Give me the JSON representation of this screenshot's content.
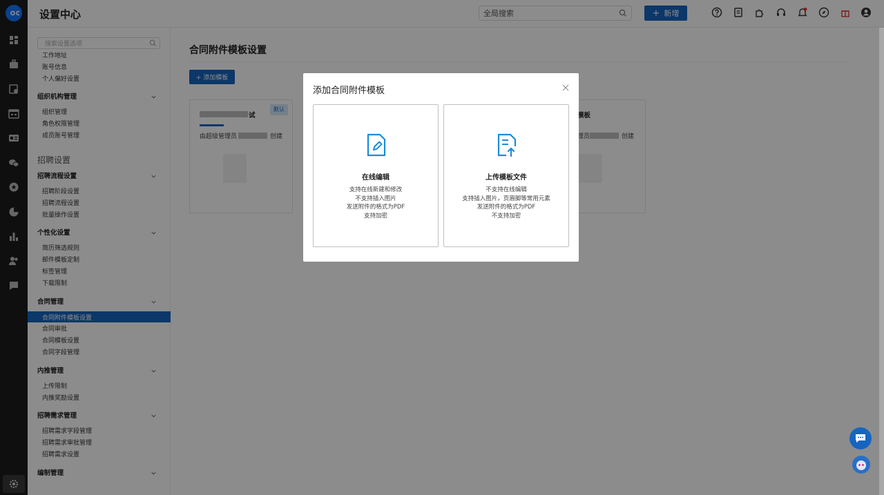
{
  "header": {
    "title": "设置中心",
    "search_placeholder": "全局搜索",
    "new_label": "新增"
  },
  "sidebar": {
    "search_placeholder": "搜索设置选项",
    "top_items": [
      "工作地址",
      "账号信息",
      "个人偏好设置"
    ],
    "groups": [
      {
        "label": "组织机构管理",
        "items": [
          "组织管理",
          "角色权限管理",
          "成员账号管理"
        ]
      },
      {
        "label": "招聘流程设置",
        "items": [
          "招聘阶段设置",
          "招聘流程设置",
          "批量操作设置"
        ]
      },
      {
        "label": "个性化设置",
        "items": [
          "简历筛选规则",
          "邮件模板定制",
          "标签管理",
          "下载限制"
        ]
      },
      {
        "label": "合同管理",
        "items": [
          "合同附件模板设置",
          "合同审批",
          "合同模板设置",
          "合同字段管理"
        ]
      },
      {
        "label": "内推管理",
        "items": [
          "上传限制",
          "内推奖励设置"
        ]
      },
      {
        "label": "招聘需求管理",
        "items": [
          "招聘需求字段管理",
          "招聘需求审批管理",
          "招聘需求设置"
        ]
      },
      {
        "label": "编制管理",
        "items": []
      }
    ],
    "section_label": "招聘设置",
    "active_item": "合同附件模板设置"
  },
  "main": {
    "page_title": "合同附件模板设置",
    "add_button": "+ 添加模板",
    "cards": [
      {
        "name_suffix": "试",
        "badge": "默认",
        "creator_prefix": "由超级管理员",
        "creator_suffix": "创建"
      },
      {
        "name_suffix": "模板",
        "creator_prefix": "理员",
        "creator_suffix": "创建"
      }
    ]
  },
  "modal": {
    "title": "添加合同附件模板",
    "options": [
      {
        "name": "在线编辑",
        "icon": "edit-document-icon",
        "lines": [
          "支持在线新建和修改",
          "不支持插入图片",
          "发送附件的格式为PDF",
          "支持加密"
        ]
      },
      {
        "name": "上传模板文件",
        "icon": "upload-document-icon",
        "lines": [
          "不支持在线编辑",
          "支持插入图片，页眉脚等常用元素",
          "发送附件的格式为PDF",
          "不支持加密"
        ]
      }
    ]
  },
  "colors": {
    "primary": "#1565c0",
    "rail": "#1d1d1d",
    "icon_blue": "#1a8cd8",
    "notify_red": "#e53935"
  }
}
